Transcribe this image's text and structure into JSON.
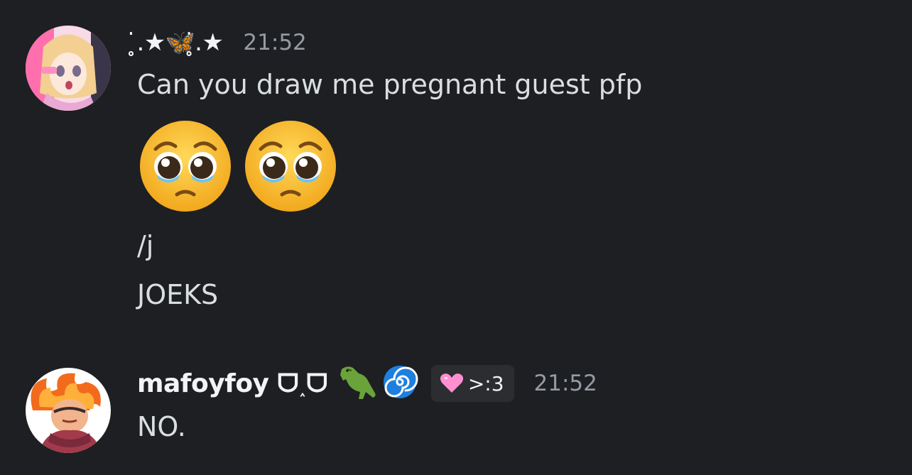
{
  "messages": [
    {
      "username": "̥̇.★🦋̥̇.★",
      "timestamp": "21:52",
      "lines": [
        "Can you draw me pregnant guest pfp",
        "/j",
        "JOEKS"
      ],
      "emojis": [
        "pleading-face",
        "pleading-face"
      ]
    },
    {
      "username": "mafoyfoy ᗜ˰ᗜ",
      "name_emojis": [
        "🦖",
        "🌀"
      ],
      "tag_icon": "💗",
      "tag_text": ">:3",
      "timestamp": "21:52",
      "lines": [
        "NO."
      ]
    }
  ]
}
